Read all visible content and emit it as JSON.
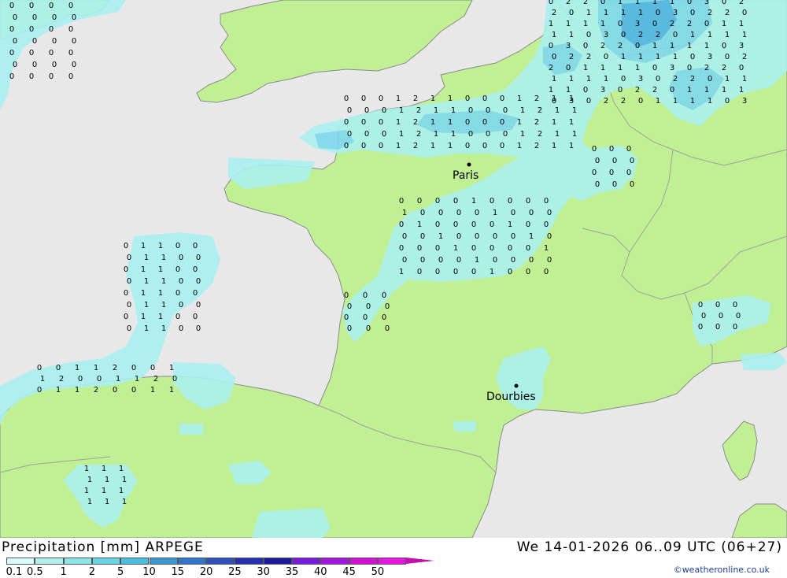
{
  "map": {
    "colors": {
      "sea": "#e8e8e8",
      "land": "#c0f093",
      "border": "#a0a0a0",
      "coast": "#8a8a8a",
      "precip_light": "#aaf0f0",
      "precip_med": "#7fd8ee",
      "precip_heavy": "#4fb4e8"
    },
    "cities": [
      {
        "name": "Paris"
      },
      {
        "name": "Dourbies"
      }
    ]
  },
  "footer": {
    "title": "Precipitation [mm] ARPEGE",
    "timestamp": "We 14-01-2026 06..09 UTC (06+27)",
    "credit": "©weatheronline.co.uk"
  },
  "legend": {
    "labels": [
      "0.1",
      "0.5",
      "1",
      "2",
      "5",
      "10",
      "15",
      "20",
      "25",
      "30",
      "35",
      "40",
      "45",
      "50"
    ],
    "colors": [
      "#d8fbfb",
      "#b0f2f2",
      "#8ae8ea",
      "#67d5e6",
      "#47bfe3",
      "#3a9ad8",
      "#3175cc",
      "#2c4fc2",
      "#2330b3",
      "#1d18a0",
      "#7a1ae0",
      "#a414e6",
      "#d40ed8",
      "#ee10e8",
      "#c010b0"
    ]
  }
}
